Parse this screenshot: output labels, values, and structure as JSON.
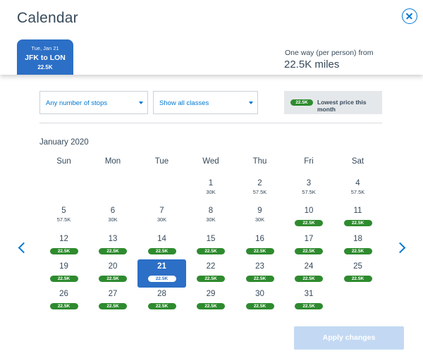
{
  "header": {
    "title": "Calendar",
    "route_tab": {
      "date": "Tue, Jan 21",
      "route": "JFK to LON",
      "price": "22.5K"
    },
    "fare_label": "One way (per person) from",
    "fare_value": "22.5K miles"
  },
  "filters": {
    "stops": "Any number of stops",
    "classes": "Show all classes",
    "legend_chip": "22.5K",
    "legend_text": "Lowest price this month"
  },
  "calendar": {
    "month": "January 2020",
    "weekdays": [
      "Sun",
      "Mon",
      "Tue",
      "Wed",
      "Thu",
      "Fri",
      "Sat"
    ],
    "selected_day": 21,
    "lowest_color": "#2e8b2e",
    "selected_color": "#2c6fc6",
    "days": [
      {
        "day": "1",
        "price": "30K",
        "lowest": false
      },
      {
        "day": "2",
        "price": "57.5K",
        "lowest": false
      },
      {
        "day": "3",
        "price": "57.5K",
        "lowest": false
      },
      {
        "day": "4",
        "price": "57.5K",
        "lowest": false
      },
      {
        "day": "5",
        "price": "57.5K",
        "lowest": false
      },
      {
        "day": "6",
        "price": "30K",
        "lowest": false
      },
      {
        "day": "7",
        "price": "30K",
        "lowest": false
      },
      {
        "day": "8",
        "price": "30K",
        "lowest": false
      },
      {
        "day": "9",
        "price": "30K",
        "lowest": false
      },
      {
        "day": "10",
        "price": "22.5K",
        "lowest": true
      },
      {
        "day": "11",
        "price": "22.5K",
        "lowest": true
      },
      {
        "day": "12",
        "price": "22.5K",
        "lowest": true
      },
      {
        "day": "13",
        "price": "22.5K",
        "lowest": true
      },
      {
        "day": "14",
        "price": "22.5K",
        "lowest": true
      },
      {
        "day": "15",
        "price": "22.5K",
        "lowest": true
      },
      {
        "day": "16",
        "price": "22.5K",
        "lowest": true
      },
      {
        "day": "17",
        "price": "22.5K",
        "lowest": true
      },
      {
        "day": "18",
        "price": "22.5K",
        "lowest": true
      },
      {
        "day": "19",
        "price": "22.5K",
        "lowest": true
      },
      {
        "day": "20",
        "price": "22.5K",
        "lowest": true
      },
      {
        "day": "21",
        "price": "22.5K",
        "lowest": true
      },
      {
        "day": "22",
        "price": "22.5K",
        "lowest": true
      },
      {
        "day": "23",
        "price": "22.5K",
        "lowest": true
      },
      {
        "day": "24",
        "price": "22.5K",
        "lowest": true
      },
      {
        "day": "25",
        "price": "22.5K",
        "lowest": true
      },
      {
        "day": "26",
        "price": "22.5K",
        "lowest": true
      },
      {
        "day": "27",
        "price": "22.5K",
        "lowest": true
      },
      {
        "day": "28",
        "price": "22.5K",
        "lowest": true
      },
      {
        "day": "29",
        "price": "22.5K",
        "lowest": true
      },
      {
        "day": "30",
        "price": "22.5K",
        "lowest": true
      },
      {
        "day": "31",
        "price": "22.5K",
        "lowest": true
      }
    ]
  },
  "icons": {
    "close": "close-circle-icon",
    "prev": "chevron-left-icon",
    "next": "chevron-right-icon"
  },
  "actions": {
    "apply": "Apply changes"
  }
}
